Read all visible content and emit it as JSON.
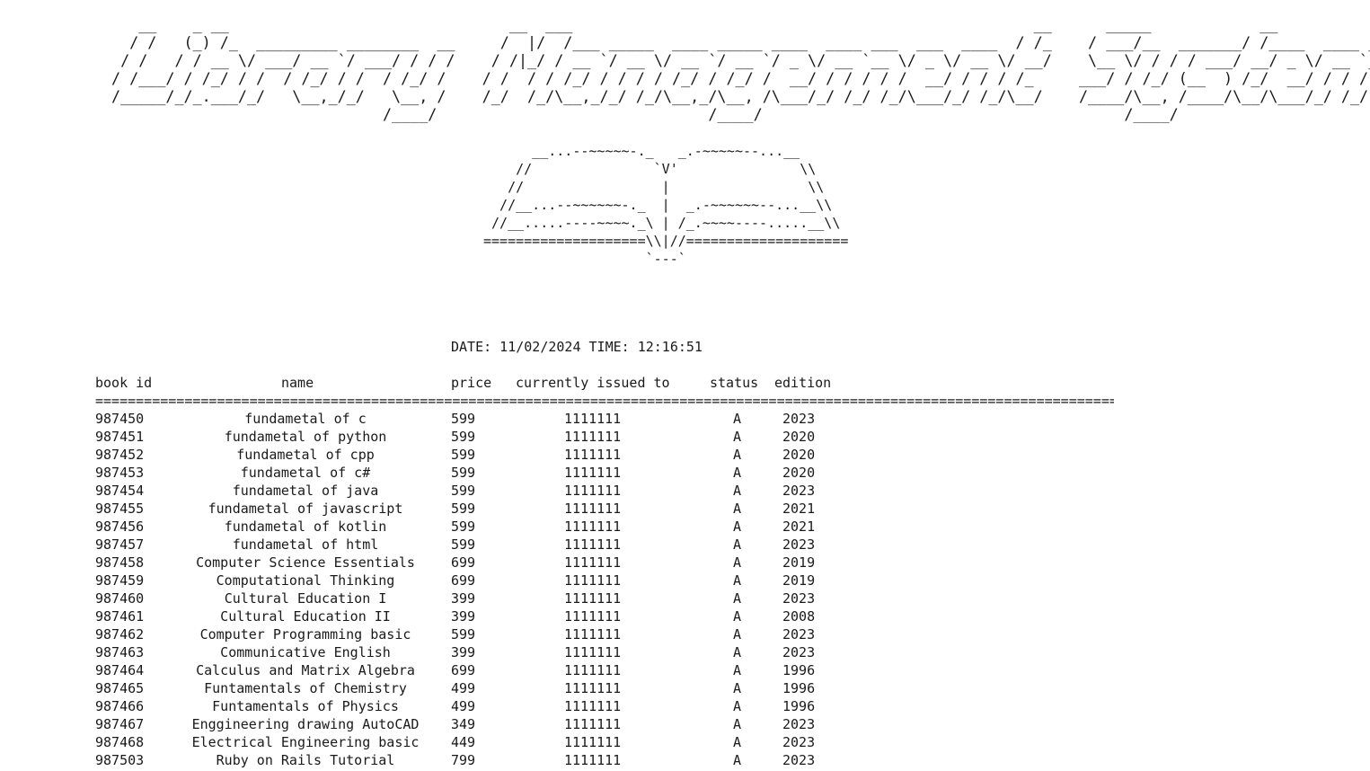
{
  "ascii_title": "   __    _ __                               __  ___                                                   __      _____            __                   \n  / /   (_) /_  _________ ________  __     /  |/  /___ _____  ____ _____ ____  ____ ___  ___  ____  / /_    / ___/__  _______/ /____  ____ ___ \n / /   / / __ \\/ ___/ __ `/ ___/ / / /    / /|_/ / __ `/ __ \\/ __ `/ __ `/ _ \\/ __ `__ \\/ _ \\/ __ \\/ __/    \\__ \\/ / / / ___/ __/ _ \\/ __ `__ \\\n/ /___/ / /_/ / /  / /_/ / /  / /_/ /    / /  / / /_/ / / / / /_/ / /_/ /  __/ / / / / /  __/ / / / /_     ___/ / /_/ (__  ) /_/  __/ / / / / /\n/_____/_/_.___/_/   \\__,_/_/   \\__, /    /_/  /_/\\__,_/_/ /_/\\__,_/\\__, /\\___/_/ /_/ /_/\\___/_/ /_/\\__/    /____/\\__, /____/\\__/\\___/_/ /_/ /_/ \n                              /____/                              /____/                                        /____/                           ",
  "ascii_book": "      __...--~~~~~-._   _.-~~~~~--...__\n    //               `V'               \\\\\n   //                 |                 \\\\\n  //__...--~~~~~~-._  |  _.-~~~~~~--...__\\\\\n //__.....----~~~~._\\ | /_.~~~~----.....__\\\\\n====================\\\\|//====================\n                    `---`",
  "datetime": "DATE: 11/02/2024 TIME: 12:16:51",
  "table": {
    "headers": {
      "book_id": "book id",
      "name": "name",
      "price": "price",
      "issued_to": "currently issued to",
      "status": "status",
      "edition": "edition"
    },
    "separator": "===============================================================================================================================",
    "rows": [
      {
        "book_id": "987450",
        "name": "fundametal of c",
        "price": "599",
        "issued_to": "1111111",
        "status": "A",
        "edition": "2023"
      },
      {
        "book_id": "987451",
        "name": "fundametal of python",
        "price": "599",
        "issued_to": "1111111",
        "status": "A",
        "edition": "2020"
      },
      {
        "book_id": "987452",
        "name": "fundametal of cpp",
        "price": "599",
        "issued_to": "1111111",
        "status": "A",
        "edition": "2020"
      },
      {
        "book_id": "987453",
        "name": "fundametal of c#",
        "price": "599",
        "issued_to": "1111111",
        "status": "A",
        "edition": "2020"
      },
      {
        "book_id": "987454",
        "name": "fundametal of java",
        "price": "599",
        "issued_to": "1111111",
        "status": "A",
        "edition": "2023"
      },
      {
        "book_id": "987455",
        "name": "fundametal of javascript",
        "price": "599",
        "issued_to": "1111111",
        "status": "A",
        "edition": "2021"
      },
      {
        "book_id": "987456",
        "name": "fundametal of kotlin",
        "price": "599",
        "issued_to": "1111111",
        "status": "A",
        "edition": "2021"
      },
      {
        "book_id": "987457",
        "name": "fundametal of html",
        "price": "599",
        "issued_to": "1111111",
        "status": "A",
        "edition": "2023"
      },
      {
        "book_id": "987458",
        "name": "Computer Science Essentials",
        "price": "699",
        "issued_to": "1111111",
        "status": "A",
        "edition": "2019"
      },
      {
        "book_id": "987459",
        "name": "Computational Thinking",
        "price": "699",
        "issued_to": "1111111",
        "status": "A",
        "edition": "2019"
      },
      {
        "book_id": "987460",
        "name": "Cultural Education I",
        "price": "399",
        "issued_to": "1111111",
        "status": "A",
        "edition": "2023"
      },
      {
        "book_id": "987461",
        "name": "Cultural Education II",
        "price": "399",
        "issued_to": "1111111",
        "status": "A",
        "edition": "2008"
      },
      {
        "book_id": "987462",
        "name": "Computer Programming basic",
        "price": "599",
        "issued_to": "1111111",
        "status": "A",
        "edition": "2023"
      },
      {
        "book_id": "987463",
        "name": "Communicative English",
        "price": "399",
        "issued_to": "1111111",
        "status": "A",
        "edition": "2023"
      },
      {
        "book_id": "987464",
        "name": "Calculus and Matrix Algebra",
        "price": "699",
        "issued_to": "1111111",
        "status": "A",
        "edition": "1996"
      },
      {
        "book_id": "987465",
        "name": "Funtamentals of Chemistry",
        "price": "499",
        "issued_to": "1111111",
        "status": "A",
        "edition": "1996"
      },
      {
        "book_id": "987466",
        "name": "Funtamentals of Physics",
        "price": "499",
        "issued_to": "1111111",
        "status": "A",
        "edition": "1996"
      },
      {
        "book_id": "987467",
        "name": "Enggineering drawing AutoCAD",
        "price": "349",
        "issued_to": "1111111",
        "status": "A",
        "edition": "2023"
      },
      {
        "book_id": "987468",
        "name": "Electrical Engineering basic",
        "price": "449",
        "issued_to": "1111111",
        "status": "A",
        "edition": "2023"
      },
      {
        "book_id": "987503",
        "name": "Ruby on Rails Tutorial",
        "price": "799",
        "issued_to": "1111111",
        "status": "A",
        "edition": "2023"
      }
    ]
  }
}
